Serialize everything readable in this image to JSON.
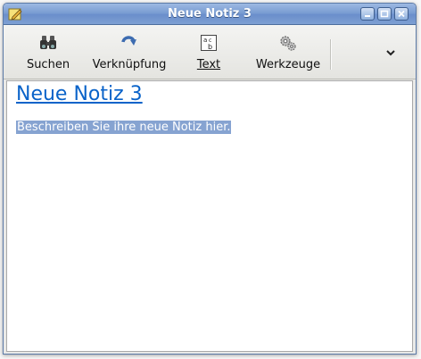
{
  "window": {
    "title": "Neue Notiz 3",
    "icons": {
      "app": "note-pencil-icon",
      "minimize": "minimize-icon",
      "maximize": "maximize-icon",
      "close": "close-icon"
    }
  },
  "toolbar": {
    "items": [
      {
        "label": "Suchen",
        "icon": "binoculars-icon"
      },
      {
        "label": "Verknüpfung",
        "icon": "link-arrow-icon"
      },
      {
        "label": "Text",
        "icon": "text-format-icon"
      },
      {
        "label": "Werkzeuge",
        "icon": "gears-icon"
      }
    ],
    "overflow_icon": "chevron-down-icon"
  },
  "note": {
    "title": "Neue Notiz 3",
    "body": "Beschreiben Sie ihre neue Notiz hier."
  },
  "colors": {
    "title_bar": "#7a9dd2",
    "link_title": "#0a63c9",
    "selection": "#86a3d1"
  }
}
